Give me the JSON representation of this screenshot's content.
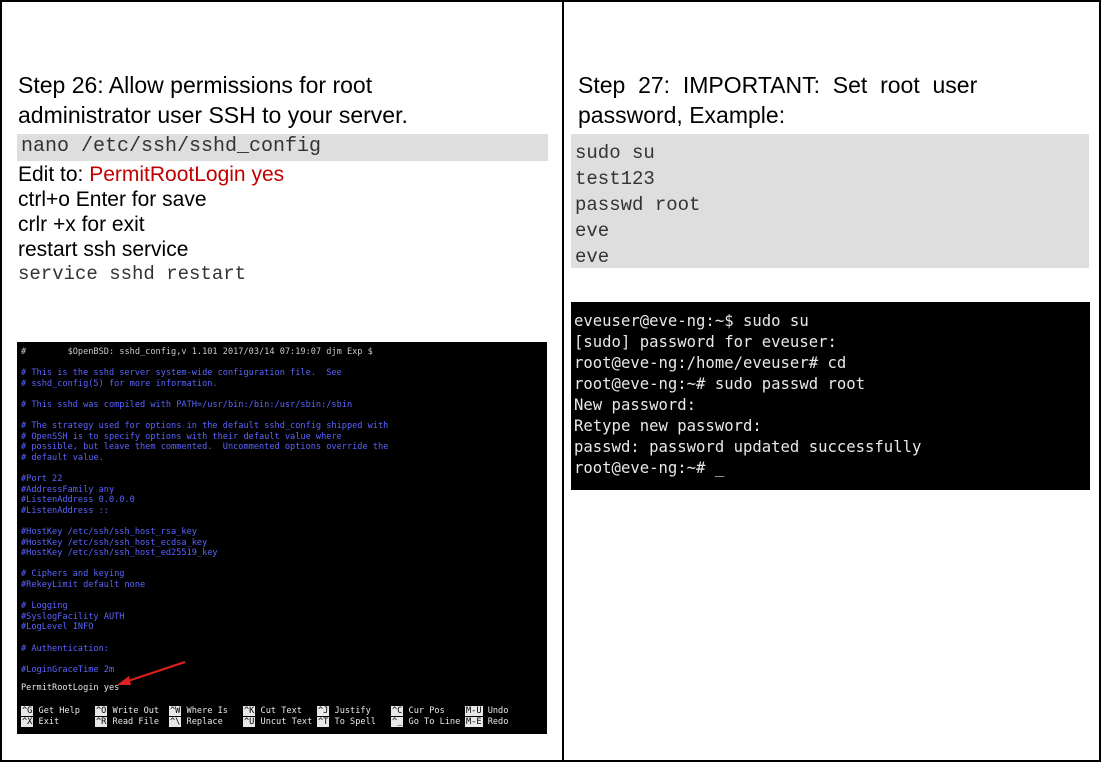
{
  "left": {
    "title_line1": "Step 26: Allow permissions for root",
    "title_line2": "administrator user SSH to your server.",
    "command_nano": "nano /etc/ssh/sshd_config",
    "edit_prefix": "Edit to: ",
    "edit_value": "PermitRootLogin yes",
    "save_line": "ctrl+o Enter for save",
    "exit_line": "crlr +x for exit",
    "restart_line": "restart ssh service",
    "restart_command": "service sshd restart"
  },
  "right": {
    "title_line1": "Step  27:  IMPORTANT:  Set  root  user",
    "title_line2": "password, Example:",
    "code_lines": [
      "sudo su",
      "test123",
      "passwd root",
      "eve",
      "eve"
    ]
  },
  "nano_screen": {
    "header": "#        $OpenBSD: sshd_config,v 1.101 2017/03/14 07:19:07 djm Exp $",
    "lines": [
      "# This is the sshd server system-wide configuration file.  See",
      "# sshd_config(5) for more information.",
      "",
      "# This sshd was compiled with PATH=/usr/bin:/bin:/usr/sbin:/sbin",
      "",
      "# The strategy used for options in the default sshd_config shipped with",
      "# OpenSSH is to specify options with their default value where",
      "# possible, but leave them commented.  Uncommented options override the",
      "# default value.",
      "",
      "#Port 22",
      "#AddressFamily any",
      "#ListenAddress 0.0.0.0",
      "#ListenAddress ::",
      "",
      "#HostKey /etc/ssh/ssh_host_rsa_key",
      "#HostKey /etc/ssh/ssh_host_ecdsa_key",
      "#HostKey /etc/ssh/ssh_host_ed25519_key",
      "",
      "# Ciphers and keying",
      "#RekeyLimit default none",
      "",
      "# Logging",
      "#SyslogFacility AUTH",
      "#LogLevel INFO",
      "",
      "# Authentication:",
      "",
      "#LoginGraceTime 2m"
    ],
    "highlight_line": "PermitRootLogin yes",
    "shortcuts": [
      {
        "key1": "^G",
        "label1": "Get Help",
        "key2": "^X",
        "label2": "Exit"
      },
      {
        "key1": "^O",
        "label1": "Write Out",
        "key2": "^R",
        "label2": "Read File"
      },
      {
        "key1": "^W",
        "label1": "Where Is",
        "key2": "^\\",
        "label2": "Replace"
      },
      {
        "key1": "^K",
        "label1": "Cut Text",
        "key2": "^U",
        "label2": "Uncut Text"
      },
      {
        "key1": "^J",
        "label1": "Justify",
        "key2": "^T",
        "label2": "To Spell"
      },
      {
        "key1": "^C",
        "label1": "Cur Pos",
        "key2": "^_",
        "label2": "Go To Line"
      },
      {
        "key1": "M-U",
        "label1": "Undo",
        "key2": "M-E",
        "label2": "Redo"
      }
    ]
  },
  "terminal_screen": {
    "lines": [
      "eveuser@eve-ng:~$ sudo su",
      "[sudo] password for eveuser:",
      "root@eve-ng:/home/eveuser# cd",
      "root@eve-ng:~# sudo passwd root",
      "New password:",
      "Retype new password:",
      "passwd: password updated successfully",
      "root@eve-ng:~# _"
    ]
  },
  "colors": {
    "red_text": "#c00000",
    "gray_bg": "#dedede",
    "nano_blue": "#5b64ff",
    "arrow_red": "#e02020"
  }
}
